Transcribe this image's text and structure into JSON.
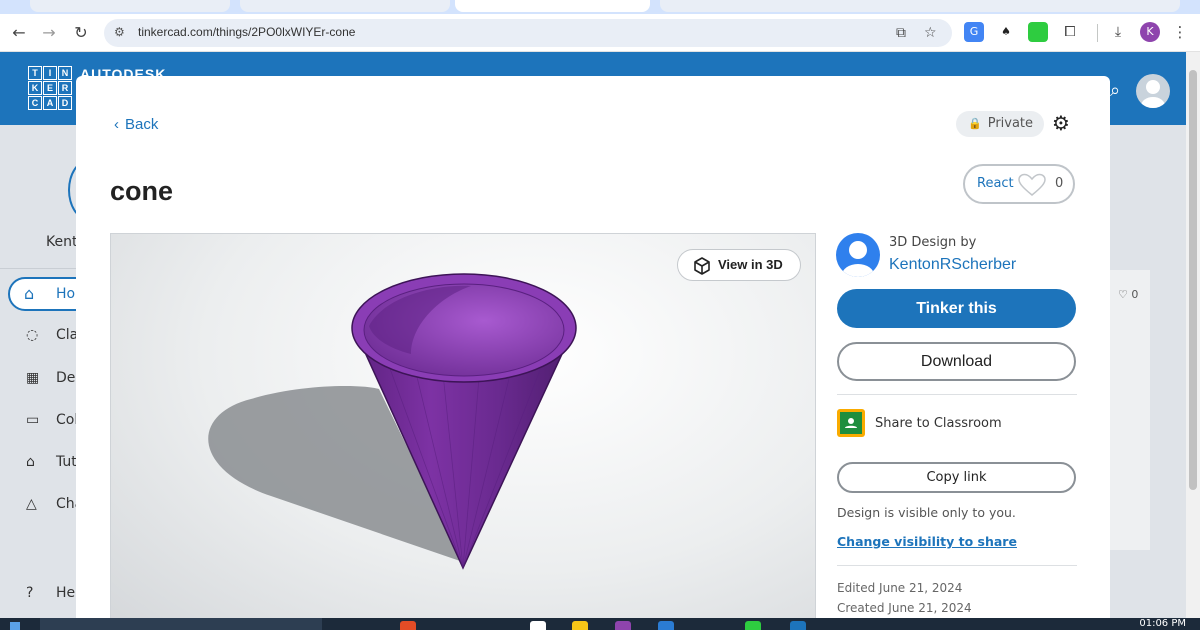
{
  "browser": {
    "url": "tinkercad.com/things/2PO0lxWIYEr-cone",
    "profile_initial": "K"
  },
  "tinkercad": {
    "logo_letters": [
      "T",
      "I",
      "N",
      "K",
      "E",
      "R",
      "C",
      "A",
      "D"
    ],
    "brand": "AUTODESK",
    "sidebar": {
      "user": "Kent",
      "items": [
        {
          "label": "Ho",
          "icon": "home-icon"
        },
        {
          "label": "Cla",
          "icon": "apple-icon"
        },
        {
          "label": "De",
          "icon": "grid-icon"
        },
        {
          "label": "Col",
          "icon": "folder-icon"
        },
        {
          "label": "Tut",
          "icon": "graduation-cap-icon"
        },
        {
          "label": "Cha",
          "icon": "shapes-icon"
        },
        {
          "label": "He",
          "icon": "help-icon"
        }
      ]
    },
    "right_heart_count": "0"
  },
  "modal": {
    "back_label": "Back",
    "title": "cone",
    "private_label": "Private",
    "react_label": "React",
    "react_count": "0",
    "view3d_label": "View in 3D",
    "author_prefix": "3D Design by",
    "author_name": "KentonRScherber",
    "tinker_label": "Tinker this",
    "download_label": "Download",
    "classroom_label": "Share to Classroom",
    "copy_link_label": "Copy link",
    "visibility_text": "Design is visible only to you.",
    "visibility_link": "Change visibility to share",
    "edited": "Edited June 21, 2024",
    "created": "Created June 21, 2024"
  },
  "taskbar": {
    "clock": "01:06 PM"
  },
  "colors": {
    "brand_blue": "#1d74bb",
    "cone_purple": "#7b2fa0"
  }
}
